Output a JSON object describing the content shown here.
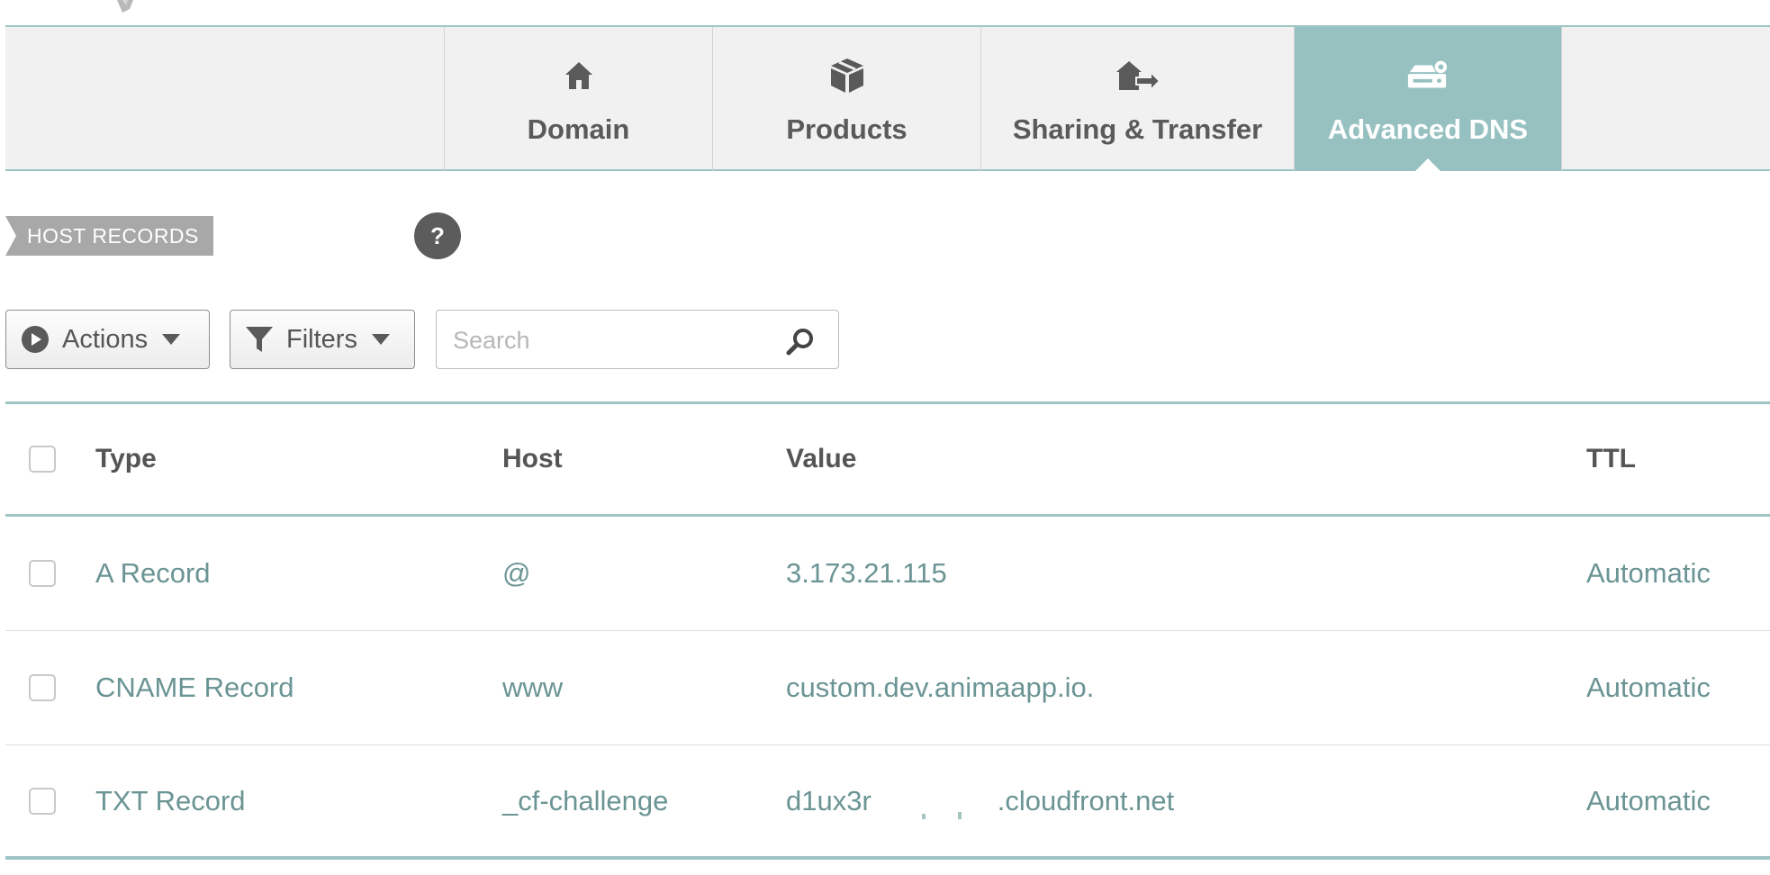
{
  "tabs": [
    {
      "label": "Domain",
      "icon": "house-icon",
      "active": false
    },
    {
      "label": "Products",
      "icon": "package-icon",
      "active": false
    },
    {
      "label": "Sharing & Transfer",
      "icon": "house-transfer-icon",
      "active": false
    },
    {
      "label": "Advanced DNS",
      "icon": "server-gear-icon",
      "active": true
    }
  ],
  "section": {
    "badge": "HOST RECORDS",
    "help": "?"
  },
  "toolbar": {
    "actions_label": "Actions",
    "filters_label": "Filters",
    "search_placeholder": "Search"
  },
  "table": {
    "headers": {
      "type": "Type",
      "host": "Host",
      "value": "Value",
      "ttl": "TTL"
    },
    "rows": [
      {
        "type": "A Record",
        "host": "@",
        "value": "3.173.21.115",
        "ttl": "Automatic"
      },
      {
        "type": "CNAME Record",
        "host": "www",
        "value": "custom.dev.animaapp.io.",
        "ttl": "Automatic"
      },
      {
        "type": "TXT Record",
        "host": "_cf-challenge",
        "value_prefix": "d1ux3r",
        "value_suffix": ".cloudfront.net",
        "ttl": "Automatic"
      }
    ]
  },
  "colors": {
    "accent": "#97c1c1",
    "row_text": "#6b9494",
    "tabbar_bg": "#f1f1f1",
    "badge_bg": "#a8a8a8",
    "help_bg": "#5c5c5c"
  }
}
